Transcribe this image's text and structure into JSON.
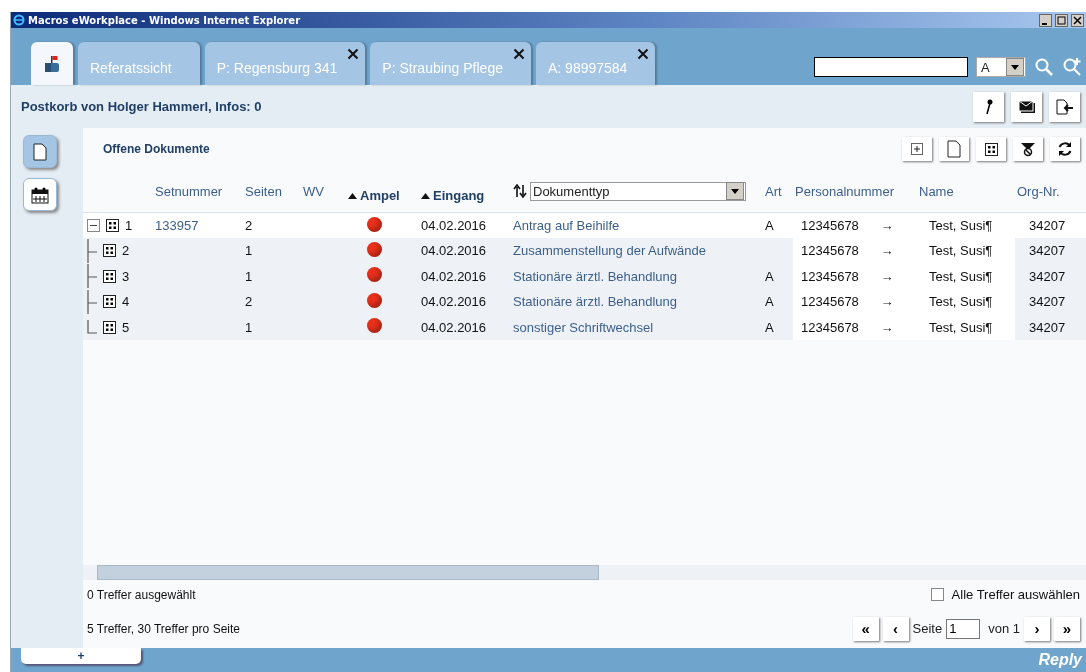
{
  "window": {
    "title": "Macros eWorkplace - Windows Internet Explorer"
  },
  "tabs": [
    {
      "kind": "home",
      "selected": true
    },
    {
      "kind": "label",
      "label": "Referatssicht",
      "selected": false,
      "closable": false
    },
    {
      "kind": "label",
      "label": "P: Regensburg 341",
      "selected": false,
      "closable": true
    },
    {
      "kind": "label",
      "label": "P: Straubing Pflege",
      "selected": false,
      "closable": true
    },
    {
      "kind": "label",
      "label": "A: 98997584",
      "selected": false,
      "closable": true
    }
  ],
  "search": {
    "scope": "A"
  },
  "header": {
    "title": "Postkorb von Holger Hammerl, Infos: 0"
  },
  "sidebar": {
    "items": [
      {
        "kind": "documents",
        "selected": true
      },
      {
        "kind": "calendar",
        "selected": false
      }
    ]
  },
  "panel": {
    "title": "Offene Dokumente"
  },
  "table": {
    "columns": [
      {
        "kind": "tree"
      },
      {
        "kind": "plain",
        "label": "Setnummer"
      },
      {
        "kind": "plain",
        "label": "Seiten"
      },
      {
        "kind": "plain",
        "label": "WV"
      },
      {
        "kind": "sorted",
        "label": "Ampel"
      },
      {
        "kind": "sorted",
        "label": "Eingang"
      },
      {
        "kind": "select",
        "label": "Dokumenttyp"
      },
      {
        "kind": "plain",
        "label": "Art"
      },
      {
        "kind": "plain",
        "label": "Personalnummer"
      },
      {
        "kind": "plain",
        "label": "Name"
      },
      {
        "kind": "plain",
        "label": "Org-Nr."
      }
    ],
    "rows": [
      {
        "number": "1",
        "set": "133957",
        "pages": "2",
        "color": "#e8301c",
        "date": "04.02.2016",
        "type": "Antrag auf Beihilfe",
        "art": "A",
        "personal": "12345678",
        "arrow": "→",
        "name": "Test, Susi¶",
        "org": "34207",
        "expanded": true,
        "children": [
          {
            "number": "2",
            "pages": "1",
            "color": "#e8301c",
            "date": "04.02.2016",
            "type": "Zusammenstellung der Aufwände",
            "personal": "12345678",
            "arrow": "→",
            "name": "Test, Susi¶",
            "org": "34207"
          },
          {
            "number": "3",
            "pages": "1",
            "color": "#e8301c",
            "date": "04.02.2016",
            "type": "Stationäre ärztl. Behandlung",
            "art": "A",
            "personal": "12345678",
            "arrow": "→",
            "name": "Test, Susi¶",
            "org": "34207"
          },
          {
            "number": "4",
            "pages": "2",
            "color": "#e8301c",
            "date": "04.02.2016",
            "type": "Stationäre ärztl. Behandlung",
            "art": "A",
            "personal": "12345678",
            "arrow": "→",
            "name": "Test, Susi¶",
            "org": "34207"
          },
          {
            "number": "5",
            "pages": "1",
            "color": "#e8301c",
            "date": "04.02.2016",
            "type": "sonstiger Schriftwechsel",
            "art": "A",
            "personal": "12345678",
            "arrow": "→",
            "name": "Test, Susi¶",
            "org": "34207"
          }
        ]
      }
    ]
  },
  "status": {
    "selected_count": "0 Treffer ausgewählt",
    "select_all": {
      "label": "Alle Treffer auswählen",
      "checked": false
    },
    "summary": "5 Treffer, 30 Treffer pro Seite"
  },
  "pager": {
    "first": "«",
    "prev": "‹",
    "page_label": "Seite",
    "page": "1",
    "of": "von 1",
    "next": "›",
    "last": "»"
  },
  "footer": {
    "add_tab": "+",
    "logo": "Reply"
  }
}
